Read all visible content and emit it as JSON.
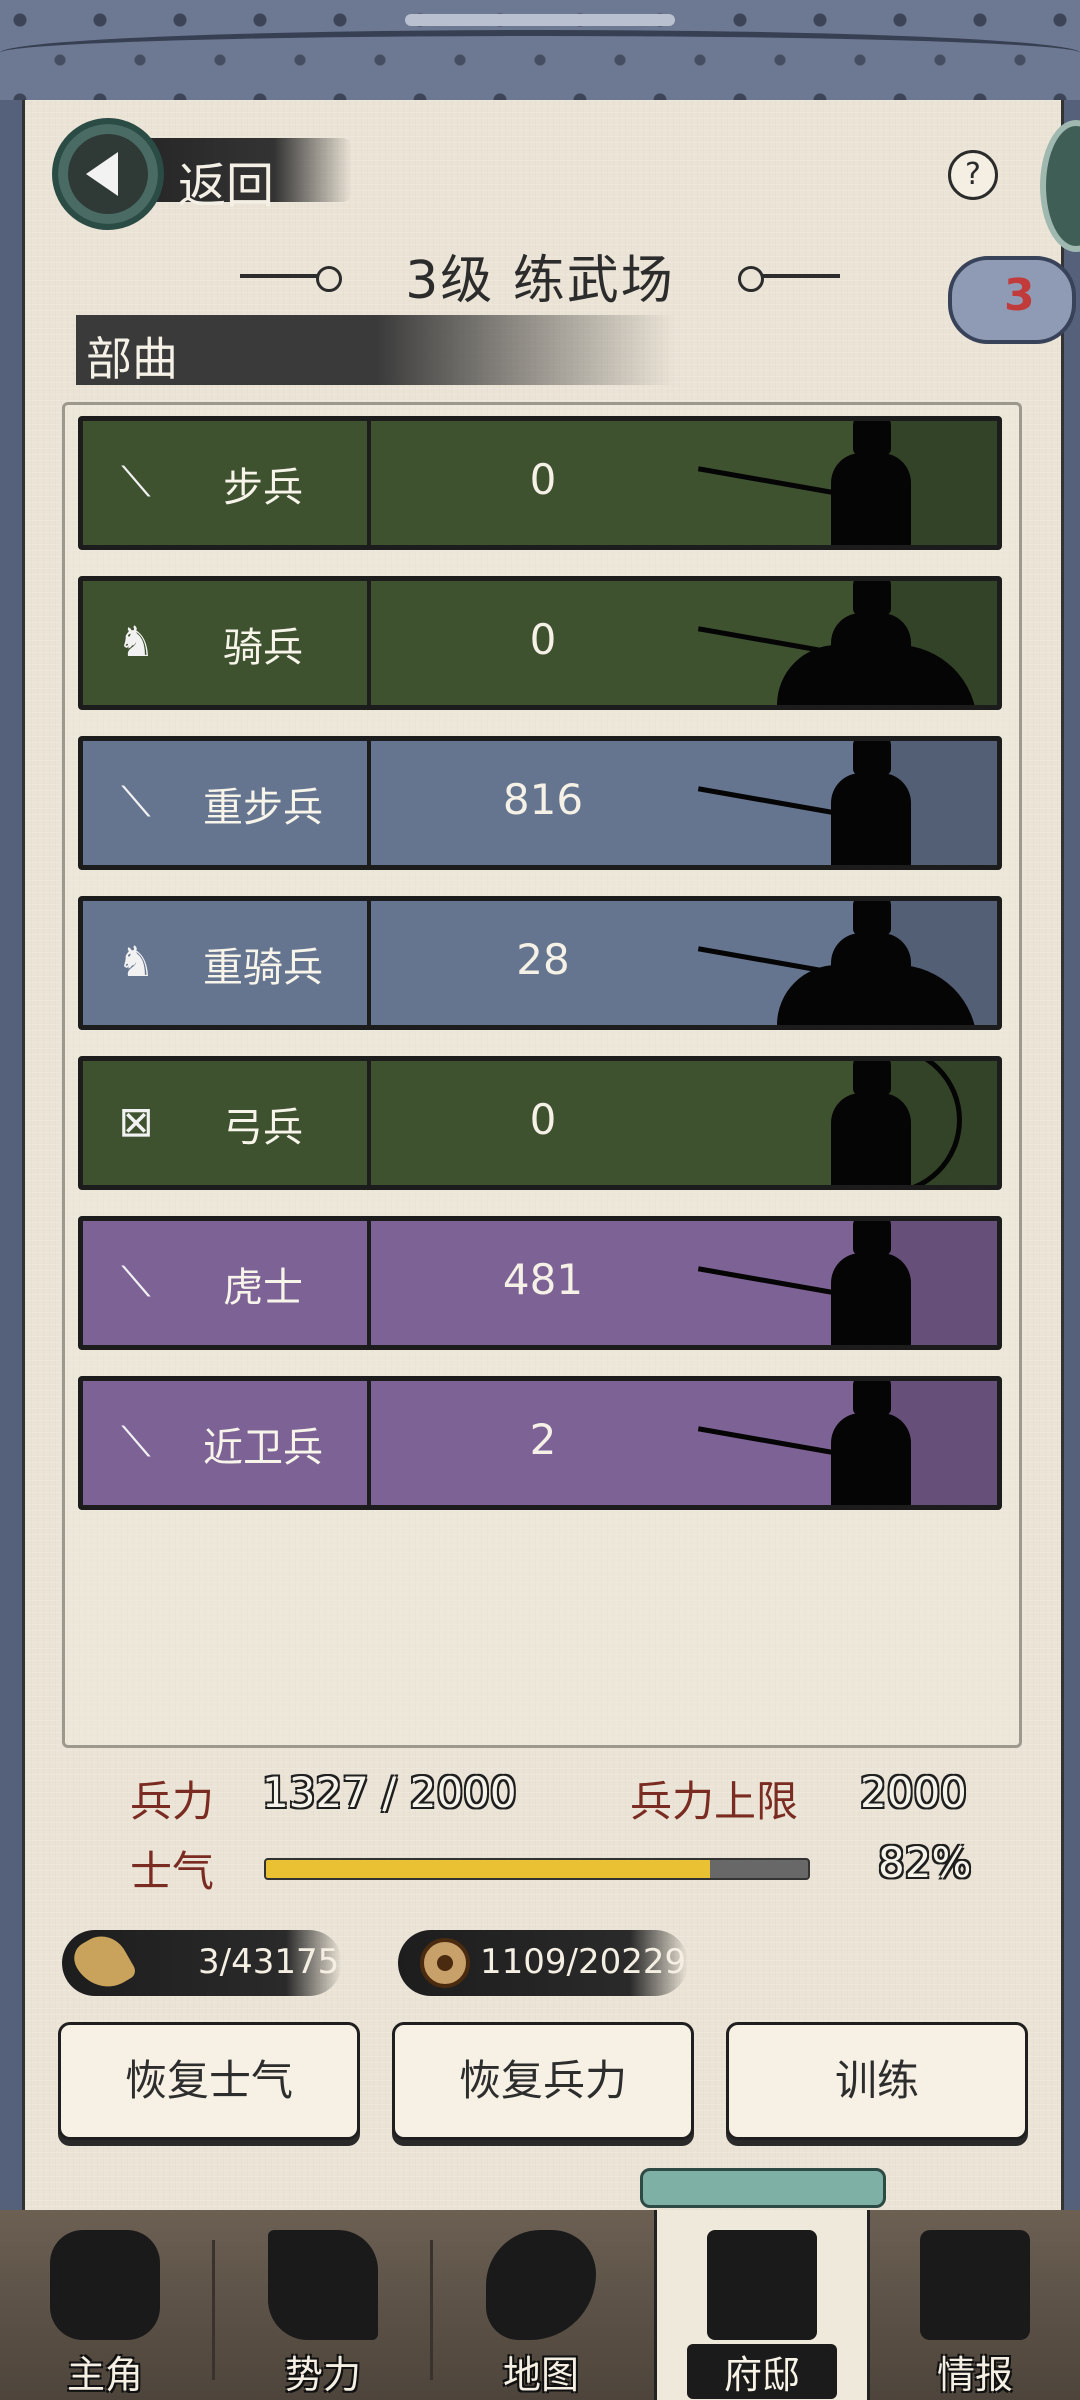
{
  "header": {
    "back_label": "返回",
    "help_symbol": "?",
    "title": "3级 练武场",
    "badge_count": "3"
  },
  "section": {
    "label": "部曲"
  },
  "troops": [
    {
      "icon": "spear-icon",
      "name": "步兵",
      "count": "0",
      "color": "#3f5230"
    },
    {
      "icon": "horse-icon",
      "name": "骑兵",
      "count": "0",
      "color": "#3f5230"
    },
    {
      "icon": "spear-icon",
      "name": "重步兵",
      "count": "816",
      "color": "#66758f"
    },
    {
      "icon": "horse-icon",
      "name": "重骑兵",
      "count": "28",
      "color": "#66758f"
    },
    {
      "icon": "bow-icon",
      "name": "弓兵",
      "count": "0",
      "color": "#3f5230"
    },
    {
      "icon": "spear-icon",
      "name": "虎士",
      "count": "481",
      "color": "#7d6295"
    },
    {
      "icon": "spear-icon",
      "name": "近卫兵",
      "count": "2",
      "color": "#7d6295"
    }
  ],
  "stats": {
    "force_label": "兵力",
    "force_value": "1327 / 2000",
    "force_cap_label": "兵力上限",
    "force_cap_value": "2000",
    "morale_label": "士气",
    "morale_value": "82%",
    "morale_fraction": 0.82
  },
  "resources": {
    "grain": "3/43175",
    "coins": "1109/20229"
  },
  "buttons": {
    "restore_morale": "恢复士气",
    "restore_force": "恢复兵力",
    "train": "训练"
  },
  "nav": [
    {
      "label": "主角",
      "icon": "hero-icon"
    },
    {
      "label": "势力",
      "icon": "banner-icon"
    },
    {
      "label": "地图",
      "icon": "map-icon"
    },
    {
      "label": "府邸",
      "icon": "mansion-icon",
      "active": true
    },
    {
      "label": "情报",
      "icon": "scroll-icon"
    }
  ],
  "colors": {
    "green_row": "#3f5230",
    "blue_row": "#66758f",
    "purple_row": "#7d6295",
    "morale_fill": "#e9c133",
    "stat_label": "#7b2c22"
  }
}
